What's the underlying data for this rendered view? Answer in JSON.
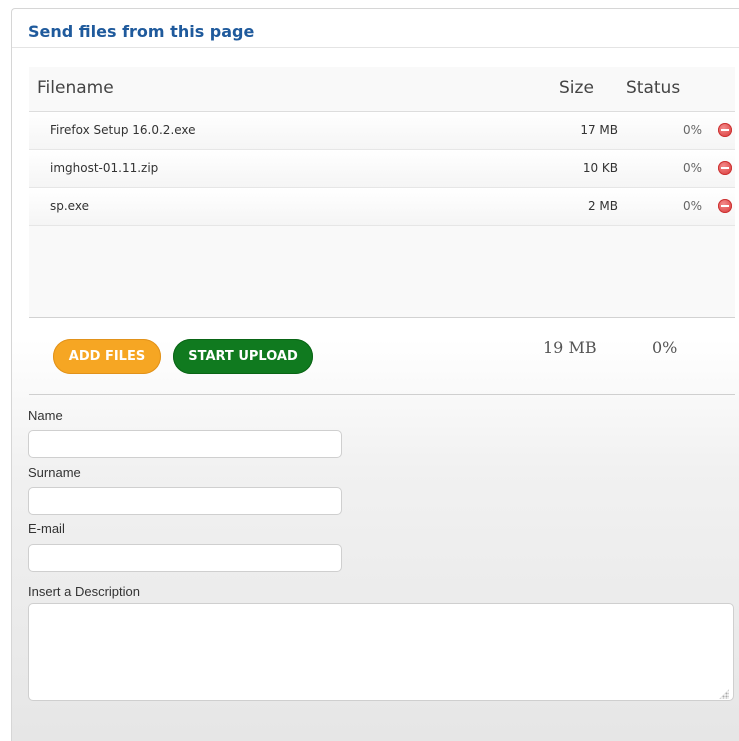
{
  "header": {
    "title": "Send files from this page"
  },
  "columns": {
    "filename": "Filename",
    "size": "Size",
    "status": "Status"
  },
  "files": [
    {
      "name": "Firefox Setup 16.0.2.exe",
      "size": "17 MB",
      "status": "0%"
    },
    {
      "name": "imghost-01.11.zip",
      "size": "10 KB",
      "status": "0%"
    },
    {
      "name": "sp.exe",
      "size": "2 MB",
      "status": "0%"
    }
  ],
  "toolbar": {
    "add_label": "ADD FILES",
    "start_label": "START UPLOAD",
    "total_size": "19 MB",
    "total_status": "0%"
  },
  "form": {
    "name_label": "Name",
    "name_value": "",
    "surname_label": "Surname",
    "surname_value": "",
    "email_label": "E-mail",
    "email_value": "",
    "description_label": "Insert a Description",
    "description_value": ""
  },
  "colors": {
    "title": "#1f5a9c",
    "add_button": "#f6a623",
    "start_button": "#107a1f",
    "remove_icon": "#d73333"
  },
  "icons": {
    "remove": "minus-circle-icon",
    "resize": "resize-grip-icon"
  }
}
